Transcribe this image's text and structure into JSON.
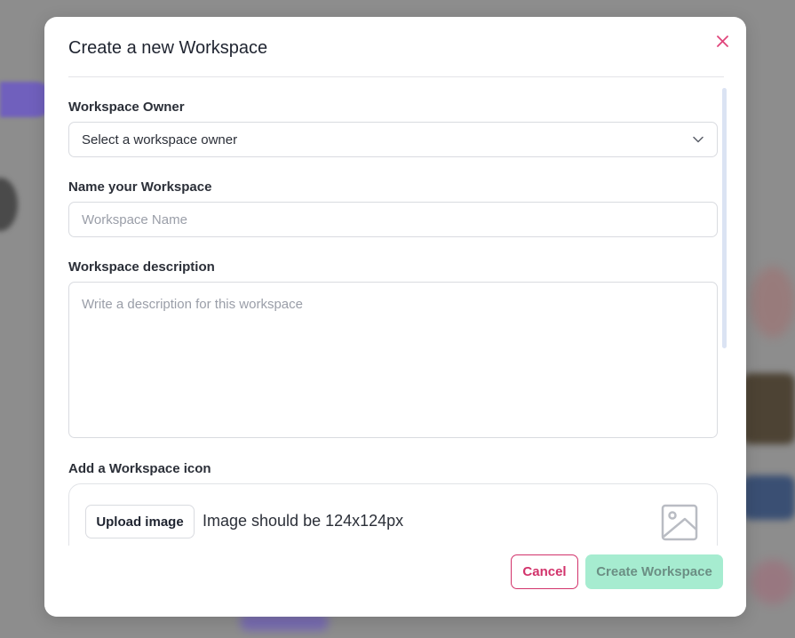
{
  "modal": {
    "title": "Create a new Workspace",
    "close_icon": "close-icon"
  },
  "owner": {
    "label": "Workspace Owner",
    "selected": "Select a workspace owner"
  },
  "name": {
    "label": "Name your Workspace",
    "placeholder": "Workspace Name",
    "value": ""
  },
  "description": {
    "label": "Workspace description",
    "placeholder": "Write a description for this workspace",
    "value": ""
  },
  "icon_upload": {
    "label": "Add a Workspace icon",
    "button": "Upload image",
    "hint": "Image should be 124x124px",
    "icon": "image-icon"
  },
  "footer": {
    "cancel": "Cancel",
    "create": "Create Workspace"
  },
  "colors": {
    "accent": "#d2336b",
    "primary_disabled": "#a6ecd0",
    "close": "#e0457b"
  }
}
